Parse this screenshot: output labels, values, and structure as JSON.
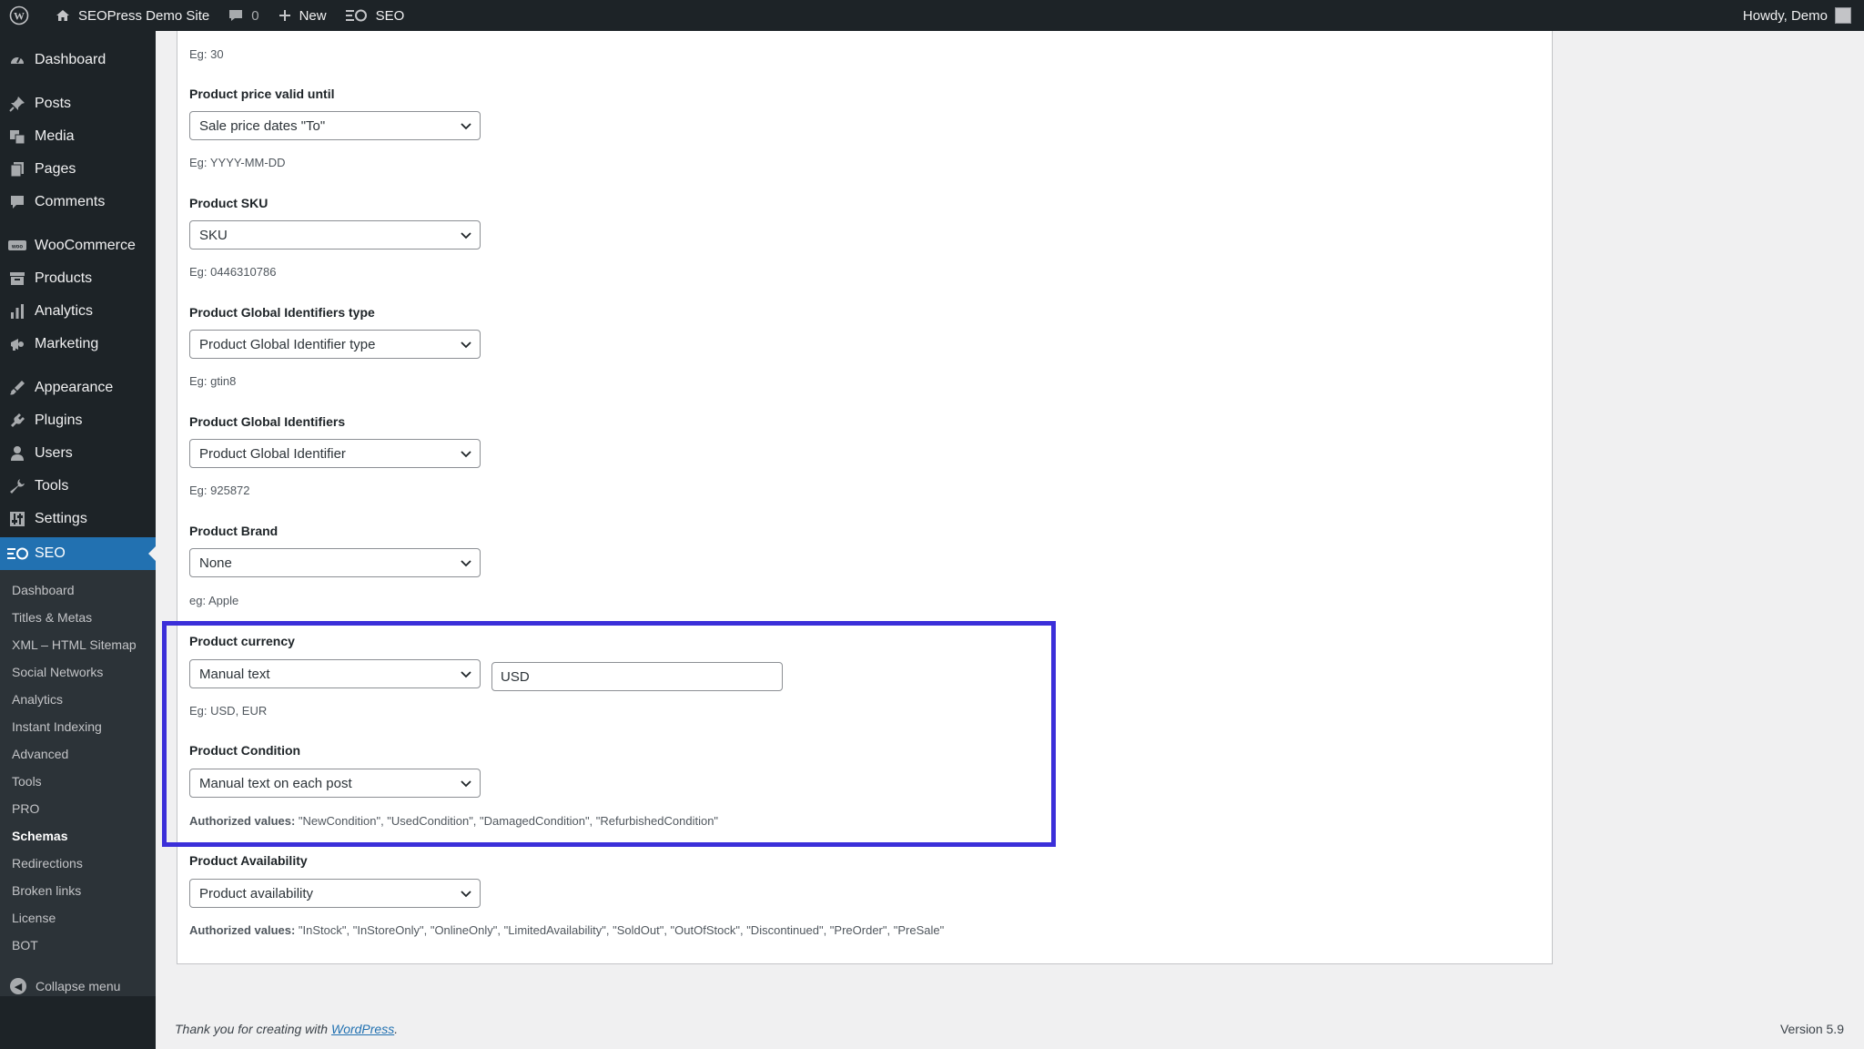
{
  "adminbar": {
    "site_name": "SEOPress Demo Site",
    "comments_count": "0",
    "new_label": "New",
    "seo_label": "SEO",
    "greeting": "Howdy, Demo"
  },
  "sidebar": {
    "items": [
      {
        "label": "Dashboard",
        "icon": "dashboard-icon"
      },
      {
        "label": "Posts",
        "icon": "pin-icon"
      },
      {
        "label": "Media",
        "icon": "media-icon"
      },
      {
        "label": "Pages",
        "icon": "pages-icon"
      },
      {
        "label": "Comments",
        "icon": "comment-icon"
      },
      {
        "label": "WooCommerce",
        "icon": "woo-icon"
      },
      {
        "label": "Products",
        "icon": "archive-icon"
      },
      {
        "label": "Analytics",
        "icon": "bar-chart-icon"
      },
      {
        "label": "Marketing",
        "icon": "megaphone-icon"
      },
      {
        "label": "Appearance",
        "icon": "brush-icon"
      },
      {
        "label": "Plugins",
        "icon": "plug-icon"
      },
      {
        "label": "Users",
        "icon": "user-icon"
      },
      {
        "label": "Tools",
        "icon": "wrench-icon"
      },
      {
        "label": "Settings",
        "icon": "sliders-icon"
      },
      {
        "label": "SEO",
        "icon": "seo-icon"
      }
    ],
    "submenu": [
      "Dashboard",
      "Titles & Metas",
      "XML – HTML Sitemap",
      "Social Networks",
      "Analytics",
      "Instant Indexing",
      "Advanced",
      "Tools",
      "PRO",
      "Schemas",
      "Redirections",
      "Broken links",
      "License",
      "BOT"
    ],
    "collapse_label": "Collapse menu"
  },
  "form": {
    "top_help": "Eg: 30",
    "fields": [
      {
        "label": "Product price valid until",
        "select": "Sale price dates \"To\"",
        "help": "Eg: YYYY-MM-DD"
      },
      {
        "label": "Product SKU",
        "select": "SKU",
        "help": "Eg: 0446310786"
      },
      {
        "label": "Product Global Identifiers type",
        "select": "Product Global Identifier type",
        "help": "Eg: gtin8"
      },
      {
        "label": "Product Global Identifiers",
        "select": "Product Global Identifier",
        "help": "Eg: 925872"
      },
      {
        "label": "Product Brand",
        "select": "None",
        "help": "eg: Apple"
      },
      {
        "label": "Product currency",
        "select": "Manual text",
        "text_value": "USD",
        "help": "Eg: USD, EUR"
      },
      {
        "label": "Product Condition",
        "select": "Manual text on each post",
        "help_prefix": "Authorized values:",
        "help": "\"NewCondition\", \"UsedCondition\", \"DamagedCondition\", \"RefurbishedCondition\""
      },
      {
        "label": "Product Availability",
        "select": "Product availability",
        "help_prefix": "Authorized values:",
        "help": "\"InStock\", \"InStoreOnly\", \"OnlineOnly\", \"LimitedAvailability\", \"SoldOut\", \"OutOfStock\", \"Discontinued\", \"PreOrder\", \"PreSale\""
      }
    ]
  },
  "footer": {
    "thanks_prefix": "Thank you for creating with",
    "wordpress_link": "WordPress",
    "thanks_suffix": ".",
    "version": "Version 5.9"
  },
  "colors": {
    "highlight": "#3b2fd9",
    "accent": "#2271b1",
    "adminbar_bg": "#1d2327"
  }
}
